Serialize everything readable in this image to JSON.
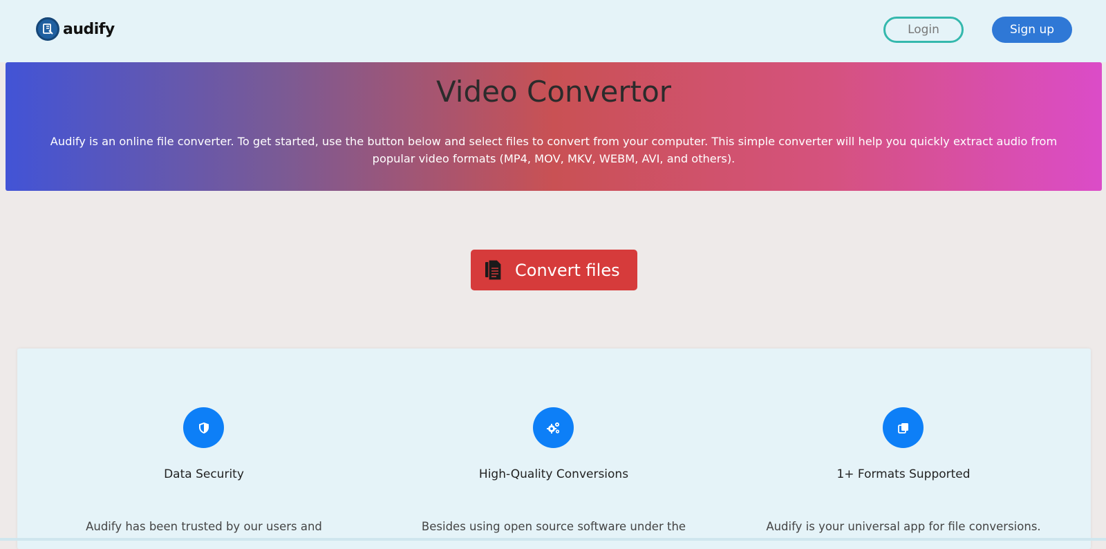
{
  "navbar": {
    "brand_name": "audify",
    "login_label": "Login",
    "signup_label": "Sign up",
    "colors": {
      "login_border": "#34b8ad",
      "signup_bg": "#2f78d6"
    }
  },
  "hero": {
    "title": "Video Convertor",
    "description": "Audify is an online file converter. To get started, use the button below and select files to convert from your computer. This simple converter will help you quickly extract audio from popular video formats (MP4, MOV, MKV, WEBM, AVI, and others).",
    "gradient_colors": [
      "#4254d6",
      "#c95154",
      "#db4cc8"
    ]
  },
  "convert": {
    "label": "Convert files",
    "icon": "file-icon",
    "color": "#d63b3b"
  },
  "features": [
    {
      "icon": "shield-icon",
      "title": "Data Security",
      "text": "Audify has been trusted by our users and"
    },
    {
      "icon": "gears-icon",
      "title": "High-Quality Conversions",
      "text": "Besides using open source software under the"
    },
    {
      "icon": "copy-icon",
      "title": "1+ Formats Supported",
      "text": "Audify is your universal app for file conversions."
    }
  ]
}
